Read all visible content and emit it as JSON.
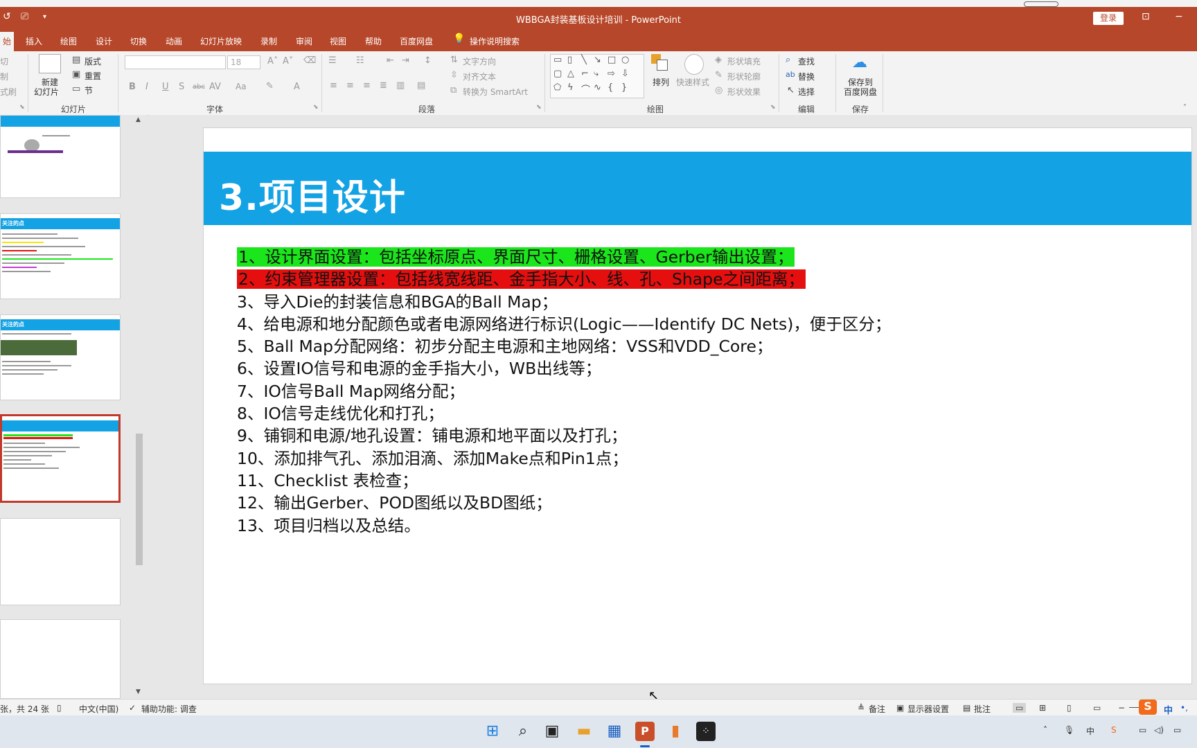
{
  "window": {
    "title": "WBBGA封装基板设计培训 - PowerPoint",
    "login": "登录"
  },
  "tabs": [
    "插入",
    "绘图",
    "设计",
    "切换",
    "动画",
    "幻灯片放映",
    "录制",
    "审阅",
    "视图",
    "帮助",
    "百度网盘"
  ],
  "active_tab_partial": "始",
  "tell_me": "操作说明搜索",
  "ribbon": {
    "clipboard_partial": [
      "切",
      "制",
      "式刷"
    ],
    "slides_group": {
      "new_slide": "新建",
      "new_slide_2": "幻灯片",
      "layout": "版式",
      "reset": "重置",
      "section": "节",
      "label": "幻灯片"
    },
    "font_group": {
      "font_size": "18",
      "label": "字体",
      "case": "Aa"
    },
    "paragraph_group": {
      "text_dir": "文字方向",
      "align_text": "对齐文本",
      "smartart": "转换为 SmartArt",
      "label": "段落"
    },
    "drawing_group": {
      "arrange": "排列",
      "quick_styles": "快速样式",
      "shape_fill": "形状填充",
      "shape_outline": "形状轮廓",
      "shape_effects": "形状效果",
      "label": "绘图"
    },
    "editing_group": {
      "find": "查找",
      "replace": "替换",
      "select": "选择",
      "label": "编辑"
    },
    "save_group": {
      "save_line1": "保存到",
      "save_line2": "百度网盘",
      "label": "保存"
    }
  },
  "thumbnails": {
    "thumb2_title": "关注的点",
    "thumb3_title": "关注的点"
  },
  "slide": {
    "title": "3.项目设计",
    "items": [
      "1、设计界面设置：包括坐标原点、界面尺寸、栅格设置、Gerber输出设置；",
      "2、约束管理器设置：包括线宽线距、金手指大小、线、孔、Shape之间距离；",
      "3、导入Die的封装信息和BGA的Ball Map；",
      "4、给电源和地分配颜色或者电源网络进行标识(Logic——Identify DC Nets)，便于区分；",
      "5、Ball  Map分配网络：初步分配主电源和主地网络：VSS和VDD_Core；",
      "6、设置IO信号和电源的金手指大小，WB出线等；",
      "7、IO信号Ball Map网络分配；",
      "8、IO信号走线优化和打孔；",
      "9、铺铜和电源/地孔设置：铺电源和地平面以及打孔；",
      "10、添加排气孔、添加泪滴、添加Make点和Pin1点；",
      "11、Checklist 表检查；",
      "12、输出Gerber、POD图纸以及BD图纸；",
      "13、项目归档以及总结。"
    ],
    "highlight_colors": {
      "item1": "#1be61b",
      "item2": "#e60f0f",
      "header": "#13a2e4"
    }
  },
  "statusbar": {
    "slide_count": "张，共 24 张",
    "language": "中文(中国)",
    "accessibility": "辅助功能: 调查",
    "notes": "备注",
    "display_settings": "显示器设置",
    "comments": "批注"
  },
  "taskbar": {
    "ime_lang": "中",
    "icons": [
      "windows-start",
      "search",
      "task-view",
      "file-explorer",
      "store",
      "powerpoint",
      "app",
      "app2"
    ]
  }
}
